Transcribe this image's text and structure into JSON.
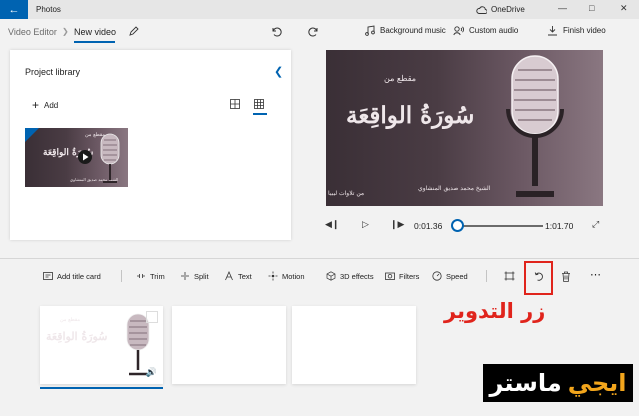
{
  "titlebar": {
    "back_icon": "back-arrow-icon",
    "title": "Photos",
    "onedrive_label": "OneDrive",
    "controls": [
      "minimize-icon",
      "maximize-icon",
      "close-icon"
    ]
  },
  "toolbar": {
    "breadcrumb_parent": "Video Editor",
    "breadcrumb_current": "New video",
    "background_music": "Background music",
    "custom_audio": "Custom audio",
    "finish_video": "Finish video"
  },
  "library": {
    "title": "Project library",
    "add_label": "Add"
  },
  "media_text": {
    "top": "مقطع من",
    "main": "سُورَةُ الواقِعَة",
    "reciter": "الشيخ محمد صديق المنشاوي",
    "source": "من تلاوات ليبيا"
  },
  "playback": {
    "current_time": "0:01.36",
    "total_time": "1:01.70"
  },
  "storyboard_toolbar": {
    "add_title_card": "Add title card",
    "trim": "Trim",
    "split": "Split",
    "text": "Text",
    "motion": "Motion",
    "effects_3d": "3D effects",
    "filters": "Filters",
    "speed": "Speed"
  },
  "storyboard": {
    "clip_duration": "1:01"
  },
  "overlay": {
    "rotate_label": "زر التدوير",
    "watermark_part1": "ايجي",
    "watermark_part2": "ماستر"
  },
  "colors": {
    "accent": "#0063b1",
    "highlight_red": "#e0241c",
    "watermark_accent": "#f2a51c"
  }
}
